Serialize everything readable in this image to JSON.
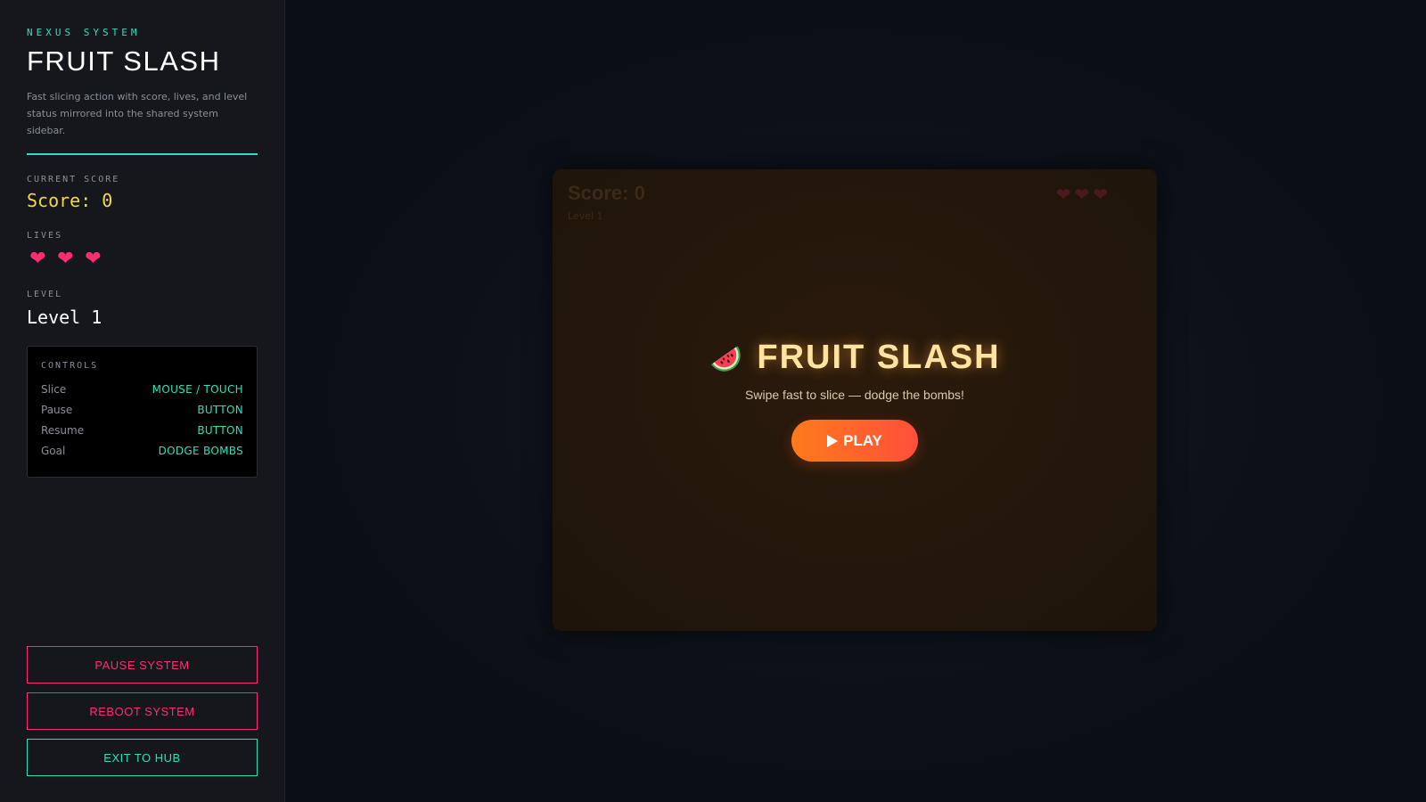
{
  "sidebar": {
    "eyebrow": "NEXUS SYSTEM",
    "title": "FRUIT SLASH",
    "description": "Fast slicing action with score, lives, and level status mirrored into the shared system sidebar.",
    "score_label": "CURRENT SCORE",
    "score_text": "Score: 0",
    "lives_label": "LIVES",
    "lives": 3,
    "heart_glyph": "❤",
    "level_label": "LEVEL",
    "level_text": "Level 1",
    "controls": {
      "title": "CONTROLS",
      "rows": [
        {
          "key": "Slice",
          "value": "MOUSE / TOUCH"
        },
        {
          "key": "Pause",
          "value": "BUTTON"
        },
        {
          "key": "Resume",
          "value": "BUTTON"
        },
        {
          "key": "Goal",
          "value": "DODGE BOMBS"
        }
      ]
    },
    "buttons": {
      "pause": "PAUSE SYSTEM",
      "reboot": "REBOOT SYSTEM",
      "exit": "EXIT TO HUB"
    }
  },
  "game": {
    "hud_score": "Score: 0",
    "hud_level": "Level 1",
    "hud_lives": 3,
    "overlay_title": "FRUIT SLASH",
    "overlay_subtitle": "Swipe fast to slice — dodge the bombs!",
    "play_label": "PLAY",
    "icon": "watermelon-icon"
  },
  "colors": {
    "accent_teal": "#2de0b8",
    "danger_pink": "#ff2d6e",
    "score_yellow": "#f5d94a",
    "play_orange": "#ff7a1c"
  }
}
